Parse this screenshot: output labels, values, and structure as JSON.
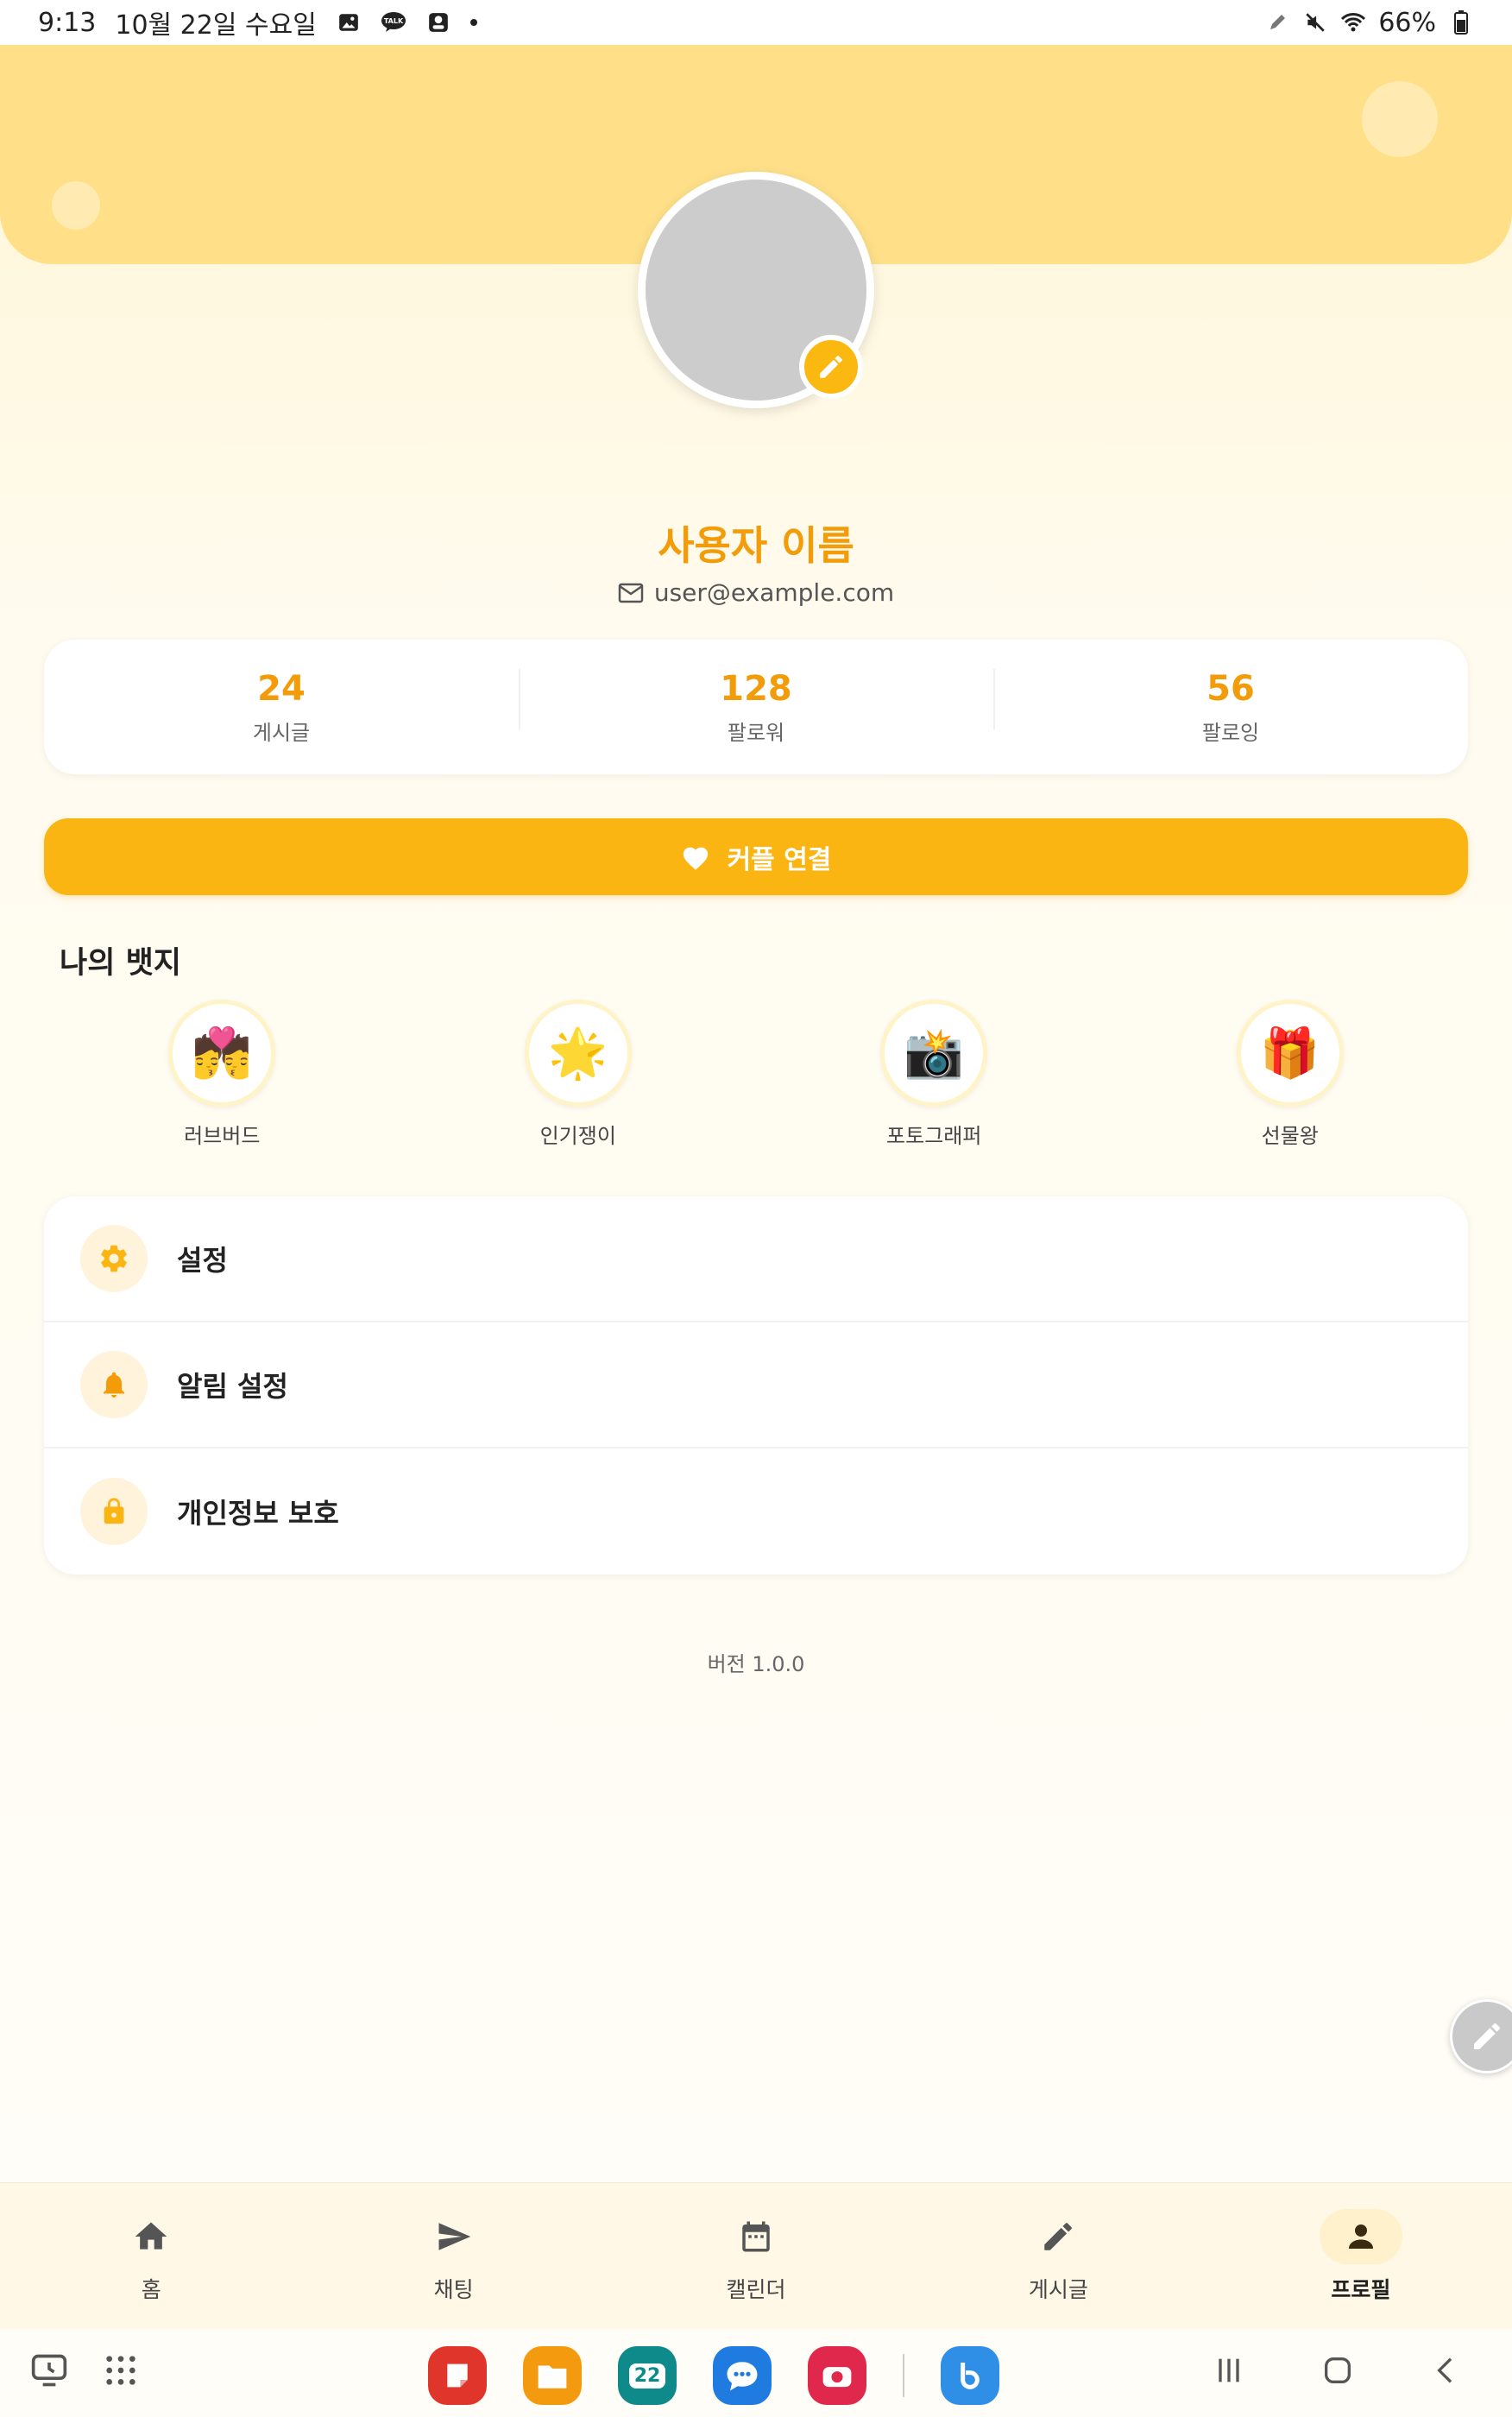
{
  "status_bar": {
    "time": "9:13",
    "date": "10월 22일 수요일",
    "notification_icons": [
      "gallery-icon",
      "kakaotalk-icon",
      "app-notification-icon"
    ],
    "battery": "66%"
  },
  "profile": {
    "name": "사용자 이름",
    "email": "user@example.com"
  },
  "stats": [
    {
      "value": "24",
      "label": "게시글"
    },
    {
      "value": "128",
      "label": "팔로워"
    },
    {
      "value": "56",
      "label": "팔로잉"
    }
  ],
  "couple_button": {
    "label": "커플 연결"
  },
  "badges_section": {
    "title": "나의 뱃지",
    "items": [
      {
        "emoji": "💏",
        "label": "러브버드"
      },
      {
        "emoji": "🌟",
        "label": "인기쟁이"
      },
      {
        "emoji": "📸",
        "label": "포토그래퍼"
      },
      {
        "emoji": "🎁",
        "label": "선물왕"
      }
    ]
  },
  "settings": [
    {
      "icon": "gear-icon",
      "label": "설정"
    },
    {
      "icon": "bell-icon",
      "label": "알림 설정"
    },
    {
      "icon": "lock-icon",
      "label": "개인정보 보호"
    }
  ],
  "version": "버전 1.0.0",
  "bottom_nav": [
    {
      "icon": "home-icon",
      "label": "홈"
    },
    {
      "icon": "send-icon",
      "label": "채팅"
    },
    {
      "icon": "calendar-icon",
      "label": "캘린더"
    },
    {
      "icon": "pencil-icon",
      "label": "게시글"
    },
    {
      "icon": "person-icon",
      "label": "프로필",
      "active": true
    }
  ],
  "taskbar": {
    "apps": [
      {
        "icon": "notes-app-icon",
        "color": "#e0352b"
      },
      {
        "icon": "files-app-icon",
        "color": "#f39a0e"
      },
      {
        "icon": "calendar-app-icon",
        "color": "#0f8a8a",
        "text": "22"
      },
      {
        "icon": "messages-app-icon",
        "color": "#1f7be0"
      },
      {
        "icon": "camera-app-icon",
        "color": "#e0284c"
      },
      {
        "icon": "bixby-app-icon",
        "color": "#2f8ee6"
      }
    ]
  },
  "colors": {
    "accent": "#f39c0a",
    "button": "#fbb513",
    "banner": "#ffe089"
  }
}
